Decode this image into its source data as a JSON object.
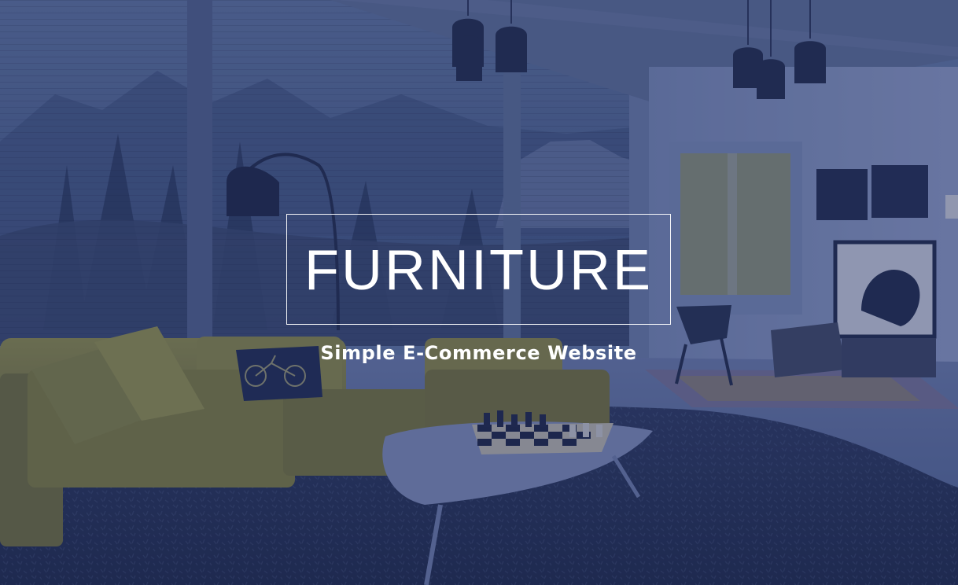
{
  "hero": {
    "title": "FURNITURE",
    "subtitle": "Simple E-Commerce Website"
  },
  "colors": {
    "overlay": "#22306a",
    "text": "#ffffff",
    "sofa": "#9b9438",
    "rug": "#263255"
  },
  "background": {
    "icon": "living-room-photo"
  }
}
